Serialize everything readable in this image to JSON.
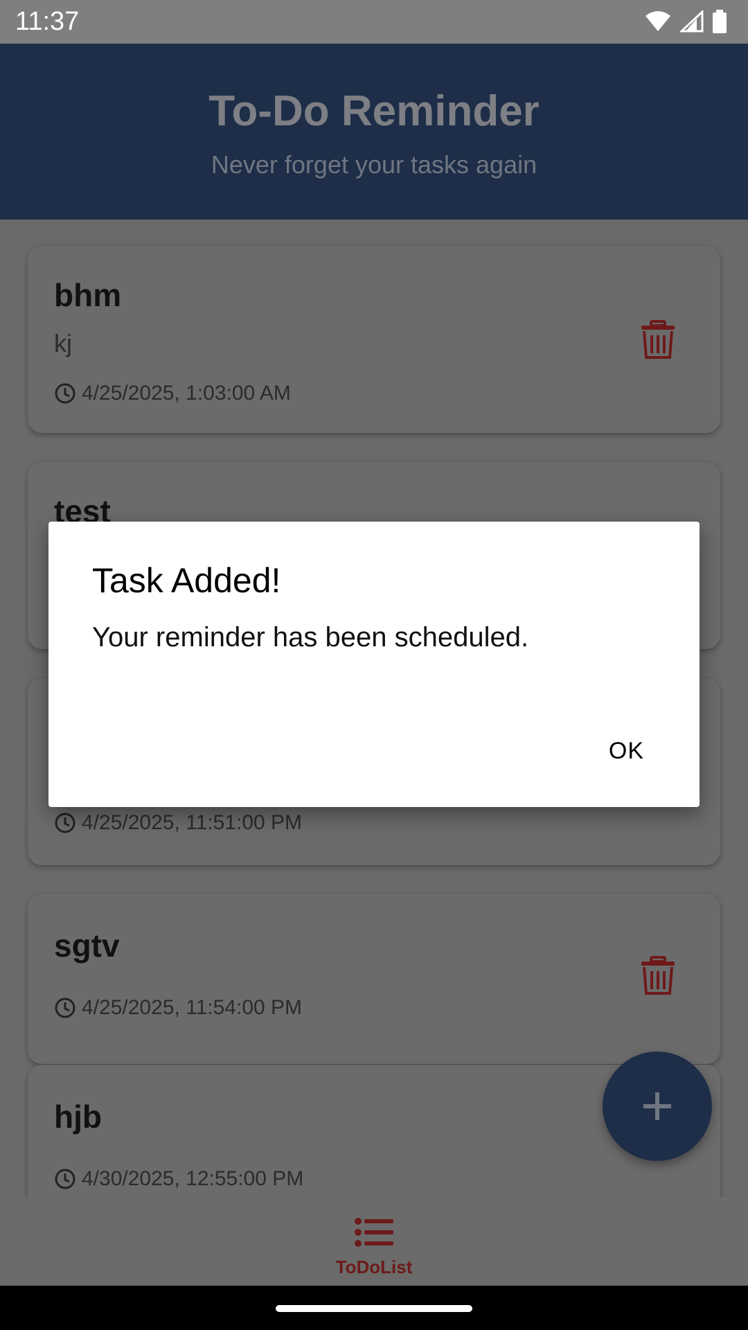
{
  "status_bar": {
    "time": "11:37"
  },
  "header": {
    "title": "To-Do Reminder",
    "subtitle": "Never forget your tasks again"
  },
  "tasks": [
    {
      "title": "bhm",
      "description": "kj",
      "datetime": "4/25/2025, 1:03:00 AM"
    },
    {
      "title": "test",
      "description": "",
      "datetime": ""
    },
    {
      "title": "",
      "description": "",
      "datetime": "4/25/2025, 11:51:00 PM"
    },
    {
      "title": "sgtv",
      "description": "",
      "datetime": "4/25/2025, 11:54:00 PM"
    },
    {
      "title": "hjb",
      "description": "",
      "datetime": "4/30/2025, 12:55:00 PM"
    }
  ],
  "nav": {
    "items": [
      {
        "label": "ToDoList",
        "icon": "list-icon",
        "active": true
      }
    ]
  },
  "dialog": {
    "title": "Task Added!",
    "message": "Your reminder has been scheduled.",
    "ok_label": "OK"
  },
  "colors": {
    "header_bg": "#1e2e48",
    "accent_red": "#8b2323",
    "fab_bg": "#1e2e48"
  }
}
